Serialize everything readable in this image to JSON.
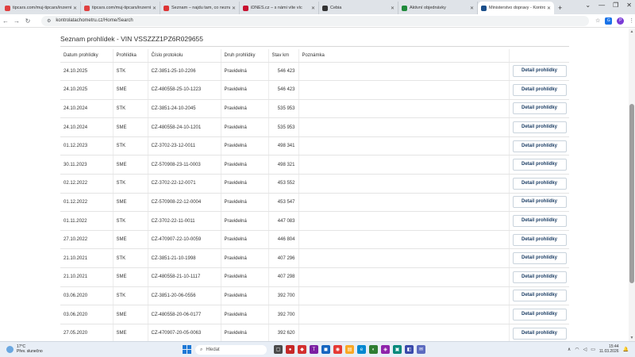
{
  "browser": {
    "tabs": [
      {
        "label": "tipcars.com/muj-tipcars/inzerni",
        "color": "#e04040",
        "active": false
      },
      {
        "label": "tipcars.com/muj-tipcars/inzerni",
        "color": "#e04040",
        "active": false
      },
      {
        "label": "Seznam – najdu tam, co nezná",
        "color": "#d33",
        "active": false
      },
      {
        "label": "iDNES.cz – s námi víte víc",
        "color": "#c8102e",
        "active": false
      },
      {
        "label": "Cebia",
        "color": "#333",
        "active": false
      },
      {
        "label": "Aktivní objednávky",
        "color": "#1f8a3a",
        "active": false
      },
      {
        "label": "Ministerstvo dopravy - Kontrol",
        "color": "#1a4e8a",
        "active": true
      }
    ],
    "url": "kontrolatachometru.cz/Home/Search"
  },
  "page": {
    "title": "Seznam prohlídek - VIN VSSZZZ1PZ6R029655",
    "columns": [
      "Datum prohlídky",
      "Prohlídka",
      "Číslo protokolu",
      "Druh prohlídky",
      "Stav km",
      "Poznámka"
    ],
    "button_label": "Detail prohlídky",
    "rows": [
      {
        "date": "24.10.2025",
        "type": "STK",
        "protocol": "CZ-3851-25-10-2206",
        "kind": "Pravidelná",
        "km": "546 423",
        "note": ""
      },
      {
        "date": "24.10.2025",
        "type": "SME",
        "protocol": "CZ-480558-25-10-1223",
        "kind": "Pravidelná",
        "km": "546 423",
        "note": ""
      },
      {
        "date": "24.10.2024",
        "type": "STK",
        "protocol": "CZ-3851-24-10-2045",
        "kind": "Pravidelná",
        "km": "535 953",
        "note": ""
      },
      {
        "date": "24.10.2024",
        "type": "SME",
        "protocol": "CZ-480558-24-10-1201",
        "kind": "Pravidelná",
        "km": "535 953",
        "note": ""
      },
      {
        "date": "01.12.2023",
        "type": "STK",
        "protocol": "CZ-3702-23-12-0011",
        "kind": "Pravidelná",
        "km": "498 341",
        "note": ""
      },
      {
        "date": "30.11.2023",
        "type": "SME",
        "protocol": "CZ-570908-23-11-0003",
        "kind": "Pravidelná",
        "km": "498 321",
        "note": ""
      },
      {
        "date": "02.12.2022",
        "type": "STK",
        "protocol": "CZ-3702-22-12-0071",
        "kind": "Pravidelná",
        "km": "453 552",
        "note": ""
      },
      {
        "date": "01.12.2022",
        "type": "SME",
        "protocol": "CZ-570908-22-12-0004",
        "kind": "Pravidelná",
        "km": "453 547",
        "note": ""
      },
      {
        "date": "01.11.2022",
        "type": "STK",
        "protocol": "CZ-3702-22-11-0011",
        "kind": "Pravidelná",
        "km": "447 083",
        "note": ""
      },
      {
        "date": "27.10.2022",
        "type": "SME",
        "protocol": "CZ-470907-22-10-0059",
        "kind": "Pravidelná",
        "km": "446 804",
        "note": ""
      },
      {
        "date": "21.10.2021",
        "type": "STK",
        "protocol": "CZ-3851-21-10-1998",
        "kind": "Pravidelná",
        "km": "407 296",
        "note": ""
      },
      {
        "date": "21.10.2021",
        "type": "SME",
        "protocol": "CZ-480558-21-10-1117",
        "kind": "Pravidelná",
        "km": "407 298",
        "note": ""
      },
      {
        "date": "03.06.2020",
        "type": "STK",
        "protocol": "CZ-3851-20-06-0556",
        "kind": "Pravidelná",
        "km": "392 700",
        "note": ""
      },
      {
        "date": "03.06.2020",
        "type": "SME",
        "protocol": "CZ-480558-20-06-0177",
        "kind": "Pravidelná",
        "km": "392 700",
        "note": ""
      },
      {
        "date": "27.05.2020",
        "type": "SME",
        "protocol": "CZ-470907-20-05-0063",
        "kind": "Pravidelná",
        "km": "392 620",
        "note": ""
      }
    ]
  },
  "taskbar": {
    "weather_temp": "17°C",
    "weather_desc": "Přev. slunečno",
    "search_placeholder": "Hledat",
    "time": "15:44",
    "date": "11.03.2026"
  }
}
